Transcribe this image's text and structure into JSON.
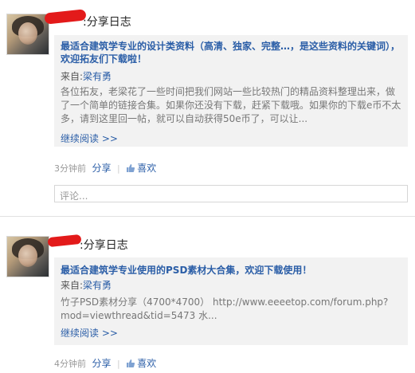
{
  "posts": [
    {
      "header_suffix": ":分享日志",
      "title": "最适合建筑学专业的设计类资料（高清、独家、完整…，是这些资料的关键词），欢迎拓友们下载啦！",
      "source_prefix": "来自:",
      "source_name": "梁有勇",
      "summary": "各位拓友，老梁花了一些时间把我们网站一些比较热门的精品资料整理出来，做了一个简单的链接合集。如果你还没有下载，赶紧下载哦。如果你的下载e币不太多，请到这里回一帖，就可以自动获得50e币了，可以让...",
      "read_more": "继续阅读 >>",
      "time": "3分钟前",
      "share": "分享",
      "like": "喜欢",
      "comment_placeholder": "评论..."
    },
    {
      "header_suffix": ":分享日志",
      "title": "最适合建筑学专业使用的PSD素材大合集，欢迎下载使用！",
      "source_prefix": "来自:",
      "source_name": "梁有勇",
      "summary": "竹子PSD素材分享（4700*4700） http://www.eeeetop.com/forum.php?mod=viewthread&tid=5473 水...",
      "read_more": "继续阅读 >>",
      "time": "4分钟前",
      "share": "分享",
      "like": "喜欢"
    }
  ],
  "icons": {
    "like": "thumbs-up-icon"
  },
  "colors": {
    "link": "#2b5ea7",
    "card_bg": "#f2f2f2",
    "redaction": "#e31a1a"
  }
}
